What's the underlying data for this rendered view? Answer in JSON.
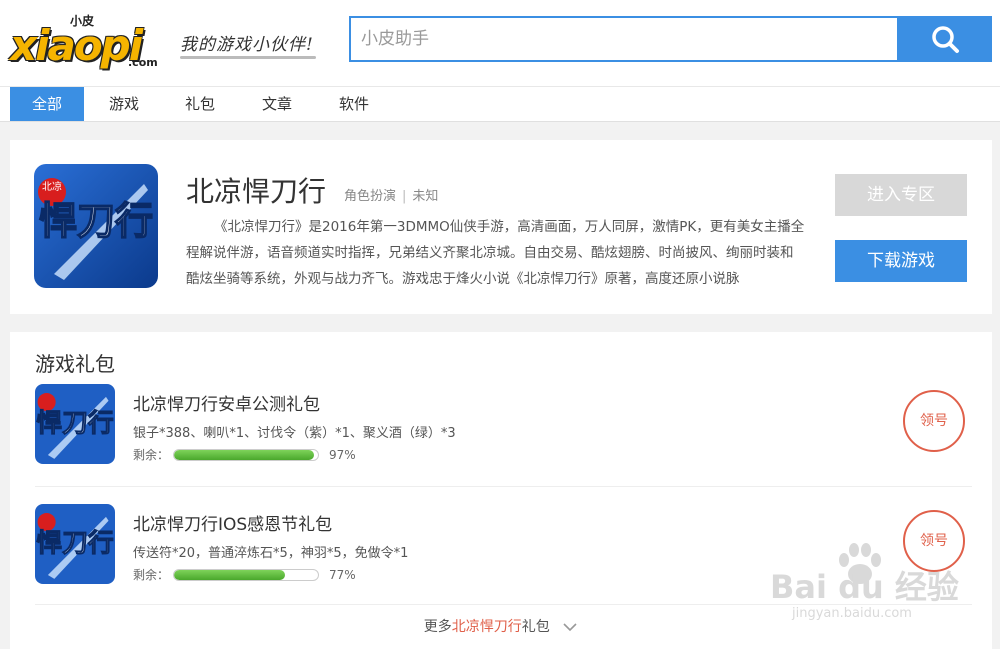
{
  "header": {
    "logo_small": "小皮",
    "logo_main": "xiaopi",
    "logo_com": ".com",
    "tagline": "我的游戏小伙伴!",
    "search_placeholder": "小皮助手"
  },
  "tabs": [
    {
      "label": "全部",
      "active": true
    },
    {
      "label": "游戏",
      "active": false
    },
    {
      "label": "礼包",
      "active": false
    },
    {
      "label": "文章",
      "active": false
    },
    {
      "label": "软件",
      "active": false
    }
  ],
  "game": {
    "title": "北凉悍刀行",
    "category": "角色扮演",
    "separator": "|",
    "status": "未知",
    "description": "《北凉悍刀行》是2016年第一3DMMO仙侠手游，高清画面，万人同屏，激情PK，更有美女主播全程解说伴游，语音频道实时指挥，兄弟结义齐聚北凉城。自由交易、酷炫翅膀、时尚披风、绚丽时装和酷炫坐骑等系统，外观与战力齐飞。游戏忠于烽火小说《北凉悍刀行》原著，高度还原小说脉",
    "zone_button": "进入专区",
    "download_button": "下载游戏",
    "icon_text_small": "北凉",
    "icon_text_big": "悍刀行"
  },
  "gifts": {
    "title": "游戏礼包",
    "items": [
      {
        "name": "北凉悍刀行安卓公测礼包",
        "content": "银子*388、喇叭*1、讨伐令（紫）*1、聚义酒（绿）*3",
        "remain_label": "剩余：",
        "remain_pct": 97,
        "remain_text": "97%",
        "claim_label": "领号"
      },
      {
        "name": "北凉悍刀行IOS感恩节礼包",
        "content": "传送符*20，普通淬炼石*5，神羽*5，免做令*1",
        "remain_label": "剩余：",
        "remain_pct": 77,
        "remain_text": "77%",
        "claim_label": "领号"
      }
    ],
    "more_prefix": "更多",
    "more_highlight": "北凉悍刀行",
    "more_suffix": "礼包"
  },
  "watermark": {
    "text": "Bai du 经验",
    "sub": "jingyan.baidu.com"
  },
  "colors": {
    "accent": "#3b8fe3",
    "claim": "#e0604a",
    "progress": "#5cbf3a"
  }
}
